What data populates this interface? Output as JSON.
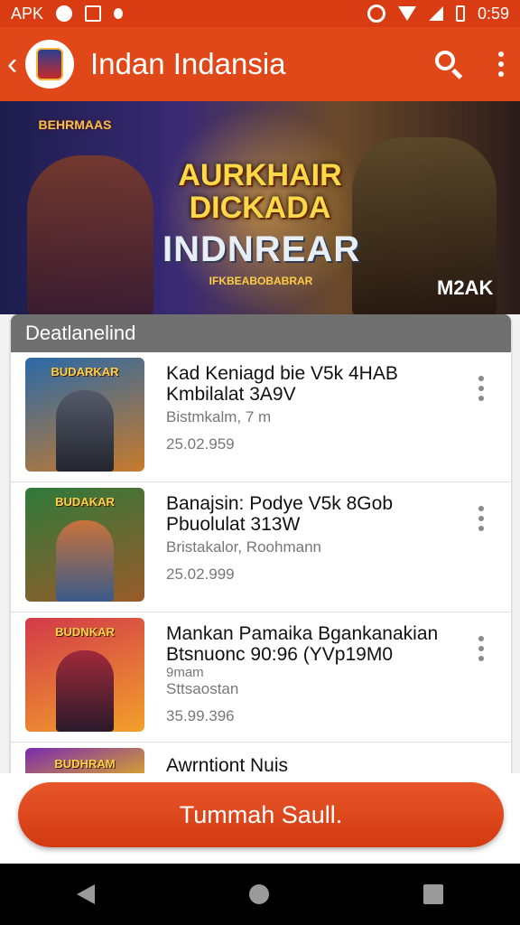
{
  "status_bar": {
    "carrier": "APK",
    "time": "0:59"
  },
  "app_bar": {
    "title": "Indan Indansia"
  },
  "banner": {
    "badge": "BEHRMAAS",
    "title": "AURKHAIR DICKADA",
    "subtitle": "INDNREAR",
    "tagline": "IFKBEABOBABRAR",
    "brand": "M2AK"
  },
  "list": {
    "header": "Deatlanelind",
    "items": [
      {
        "thumb_label": "BUDARKAR",
        "title_line1": "Kad Keniagd bie V5k 4HAB",
        "title_line2": "Kmbilalat 3A9V",
        "meta": "Bistmkalm, 7 m",
        "date": "25.02.959",
        "thumb_colors": [
          "#2a6aa8",
          "#c87a2a"
        ]
      },
      {
        "thumb_label": "BUDAKAR",
        "title_line1": "Banajsin: Podye V5k 8Gob",
        "title_line2": "Pbuolulat 313W",
        "meta": "Bristakalor, Roohmann",
        "date": "25.02.999",
        "thumb_colors": [
          "#2f7a3a",
          "#9a5a2a"
        ]
      },
      {
        "thumb_label": "BUDNKAR",
        "title_line1": "Mankan Pamaika Bgankanakian",
        "title_line2": "Btsnuonc 90:96 (YVp19M0",
        "meta": "9mam",
        "meta2": "Sttsaostan",
        "date": "35.99.396",
        "thumb_colors": [
          "#d23a4a",
          "#f2a02a"
        ]
      },
      {
        "thumb_label": "BUDHRAM",
        "title_line1": "Awrntiont Nuis",
        "thumb_colors": [
          "#7a2ab0",
          "#e0b020"
        ]
      }
    ]
  },
  "action_button": {
    "label": "Tummah Saull."
  },
  "colors": {
    "primary": "#e0481a",
    "status_bar": "#d93b12",
    "list_header": "#707070"
  }
}
